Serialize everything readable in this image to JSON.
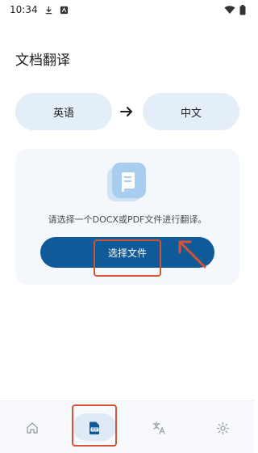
{
  "status_bar": {
    "time": "10:34",
    "icons": [
      "download-icon",
      "notification-app-icon",
      "wifi-icon",
      "battery-icon"
    ]
  },
  "page": {
    "title": "文档翻译"
  },
  "languages": {
    "source": "英语",
    "target": "中文"
  },
  "upload_card": {
    "hint": "请选择一个DOCX或PDF文件进行翻译。",
    "button_label": "选择文件"
  },
  "bottom_nav": {
    "items": [
      {
        "icon": "home-icon",
        "active": false
      },
      {
        "icon": "document-translate-icon",
        "active": true
      },
      {
        "icon": "text-translate-icon",
        "active": false
      },
      {
        "icon": "settings-icon",
        "active": false
      }
    ]
  },
  "colors": {
    "accent": "#105a9a",
    "pill": "#e3eef9",
    "card": "#f4f7fb",
    "highlight": "#d45436"
  }
}
